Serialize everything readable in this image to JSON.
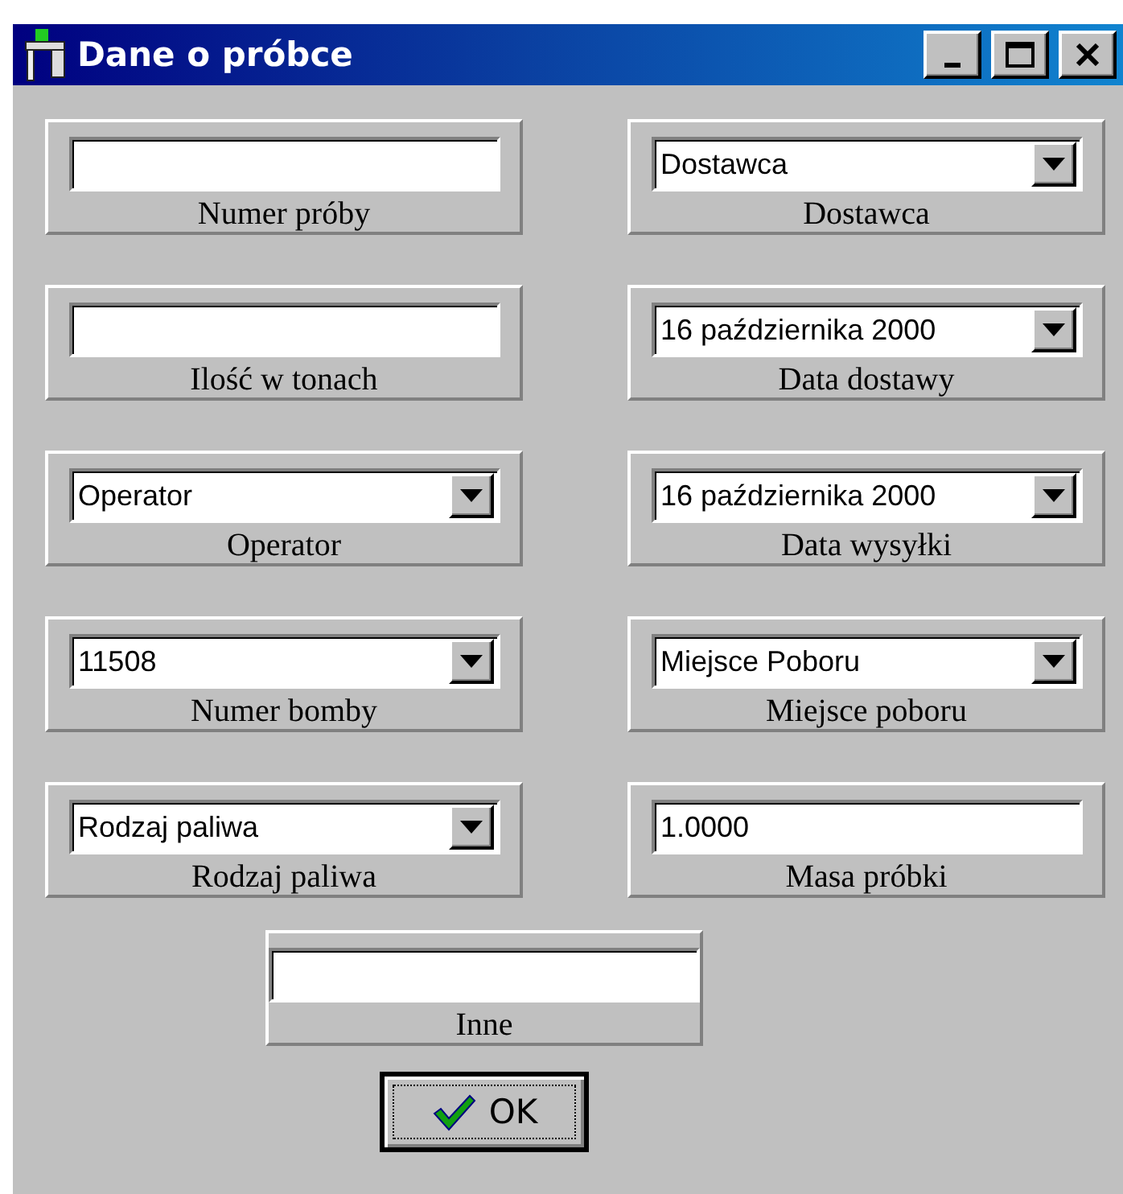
{
  "window": {
    "title": "Dane o próbce",
    "buttons": [
      {
        "kind": "minimize"
      },
      {
        "kind": "maximize"
      },
      {
        "kind": "close"
      }
    ]
  },
  "fields": [
    {
      "kind": "text",
      "label": "Numer próby"
    },
    {
      "kind": "combo",
      "value": "Dostawca",
      "label": "Dostawca"
    },
    {
      "kind": "text",
      "label": "Ilość w tonach"
    },
    {
      "kind": "combo",
      "value": "16 października 2000",
      "label": "Data dostawy"
    },
    {
      "kind": "combo",
      "value": "Operator",
      "label": "Operator"
    },
    {
      "kind": "combo",
      "value": "16 października 2000",
      "label": "Data wysyłki"
    },
    {
      "kind": "combo",
      "value": "11508",
      "label": "Numer bomby"
    },
    {
      "kind": "combo",
      "value": "Miejsce Poboru",
      "label": "Miejsce poboru"
    },
    {
      "kind": "combo",
      "value": "Rodzaj paliwa",
      "label": "Rodzaj paliwa"
    },
    {
      "kind": "text",
      "value": "1.0000",
      "label": "Masa próbki"
    },
    {
      "kind": "text",
      "label": "Inne"
    }
  ],
  "ok_button": {
    "label": "OK"
  }
}
